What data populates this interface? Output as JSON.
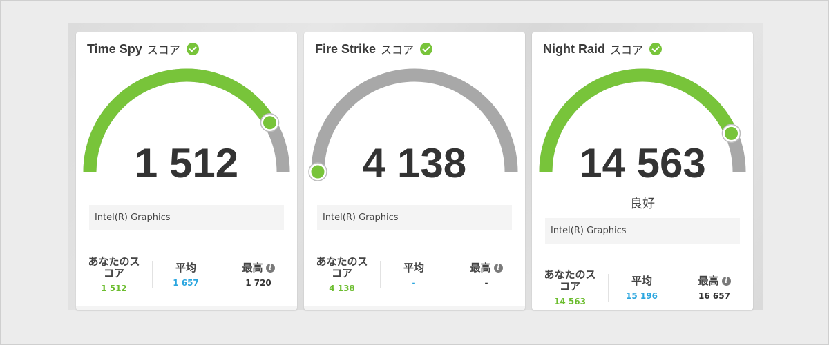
{
  "colors": {
    "accent_green": "#78c43a",
    "gauge_gray": "#a8a8a8",
    "average_blue": "#2ba6df"
  },
  "cards": [
    {
      "title_name": "Time Spy",
      "title_suffix": "スコア",
      "score": "1 512",
      "gauge_fraction": 0.83,
      "rating": "",
      "gpu": "Intel(R) Graphics",
      "your_label": "あなたのスコア",
      "your_value": "1 512",
      "avg_label": "平均",
      "avg_value": "1 657",
      "max_label": "最高",
      "max_value": "1 720",
      "info_icon": "info-icon"
    },
    {
      "title_name": "Fire Strike",
      "title_suffix": "スコア",
      "score": "4 138",
      "gauge_fraction": 0.0,
      "rating": "",
      "gpu": "Intel(R) Graphics",
      "your_label": "あなたのスコア",
      "your_value": "4 138",
      "avg_label": "平均",
      "avg_value": "-",
      "max_label": "最高",
      "max_value": "-",
      "info_icon": "info-icon"
    },
    {
      "title_name": "Night Raid",
      "title_suffix": "スコア",
      "score": "14 563",
      "gauge_fraction": 0.87,
      "rating": "良好",
      "gpu": "Intel(R) Graphics",
      "your_label": "あなたのスコア",
      "your_value": "14 563",
      "avg_label": "平均",
      "avg_value": "15 196",
      "max_label": "最高",
      "max_value": "16 657",
      "info_icon": "info-icon"
    }
  ]
}
